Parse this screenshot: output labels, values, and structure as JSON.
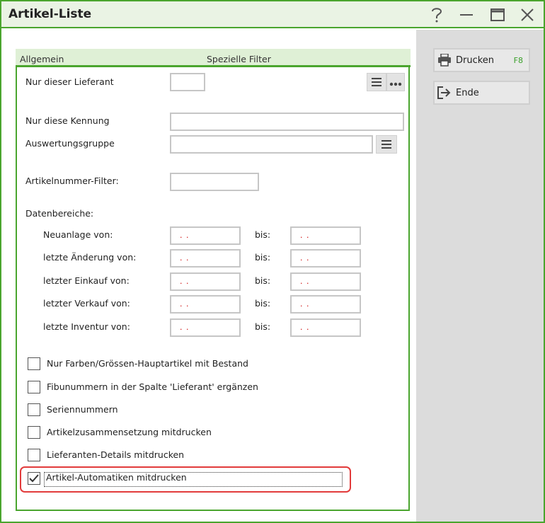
{
  "window": {
    "title": "Artikel-Liste"
  },
  "titlebar": {
    "help_icon": "question-icon",
    "minimize_icon": "minimize-icon",
    "maximize_icon": "maximize-icon",
    "close_icon": "close-icon"
  },
  "tabs": [
    {
      "label": "Allgemein"
    },
    {
      "label": "Spezielle Filter"
    }
  ],
  "form": {
    "lieferant_label": "Nur dieser Lieferant",
    "lieferant_value": "",
    "kennung_label": "Nur diese Kennung",
    "kennung_value": "",
    "auswertung_label": "Auswertungsgruppe",
    "auswertung_value": "",
    "artikelnummer_label": "Artikelnummer-Filter:",
    "artikelnummer_value": "",
    "datenbereiche_label": "Datenbereiche:",
    "bis_label": "bis:",
    "date_rows": [
      {
        "label": "Neuanlage von:",
        "from": ". .",
        "to": ". ."
      },
      {
        "label": "letzte Änderung von:",
        "from": ". .",
        "to": ". ."
      },
      {
        "label": "letzter Einkauf von:",
        "from": ". .",
        "to": ". ."
      },
      {
        "label": "letzter Verkauf von:",
        "from": ". .",
        "to": ". ."
      },
      {
        "label": "letzte Inventur von:",
        "from": ". .",
        "to": ". ."
      }
    ],
    "checkboxes": [
      {
        "label": "Nur Farben/Grössen-Hauptartikel mit Bestand",
        "checked": false
      },
      {
        "label": "Fibunummern in der Spalte 'Lieferant' ergänzen",
        "checked": false
      },
      {
        "label": "Seriennummern",
        "checked": false
      },
      {
        "label": "Artikelzusammensetzung mitdrucken",
        "checked": false
      },
      {
        "label": "Lieferanten-Details mitdrucken",
        "checked": false
      },
      {
        "label": "Artikel-Automatiken mitdrucken",
        "checked": true
      }
    ]
  },
  "sidebar": {
    "print_label": "Drucken",
    "print_shortcut": "F8",
    "end_label": "Ende"
  },
  "colors": {
    "accent": "#4aa52e",
    "tab_bg": "#dff0d6",
    "sidebar_bg": "#dcdcdc",
    "highlight": "#e23b3b",
    "date_placeholder": "#cc0000"
  }
}
